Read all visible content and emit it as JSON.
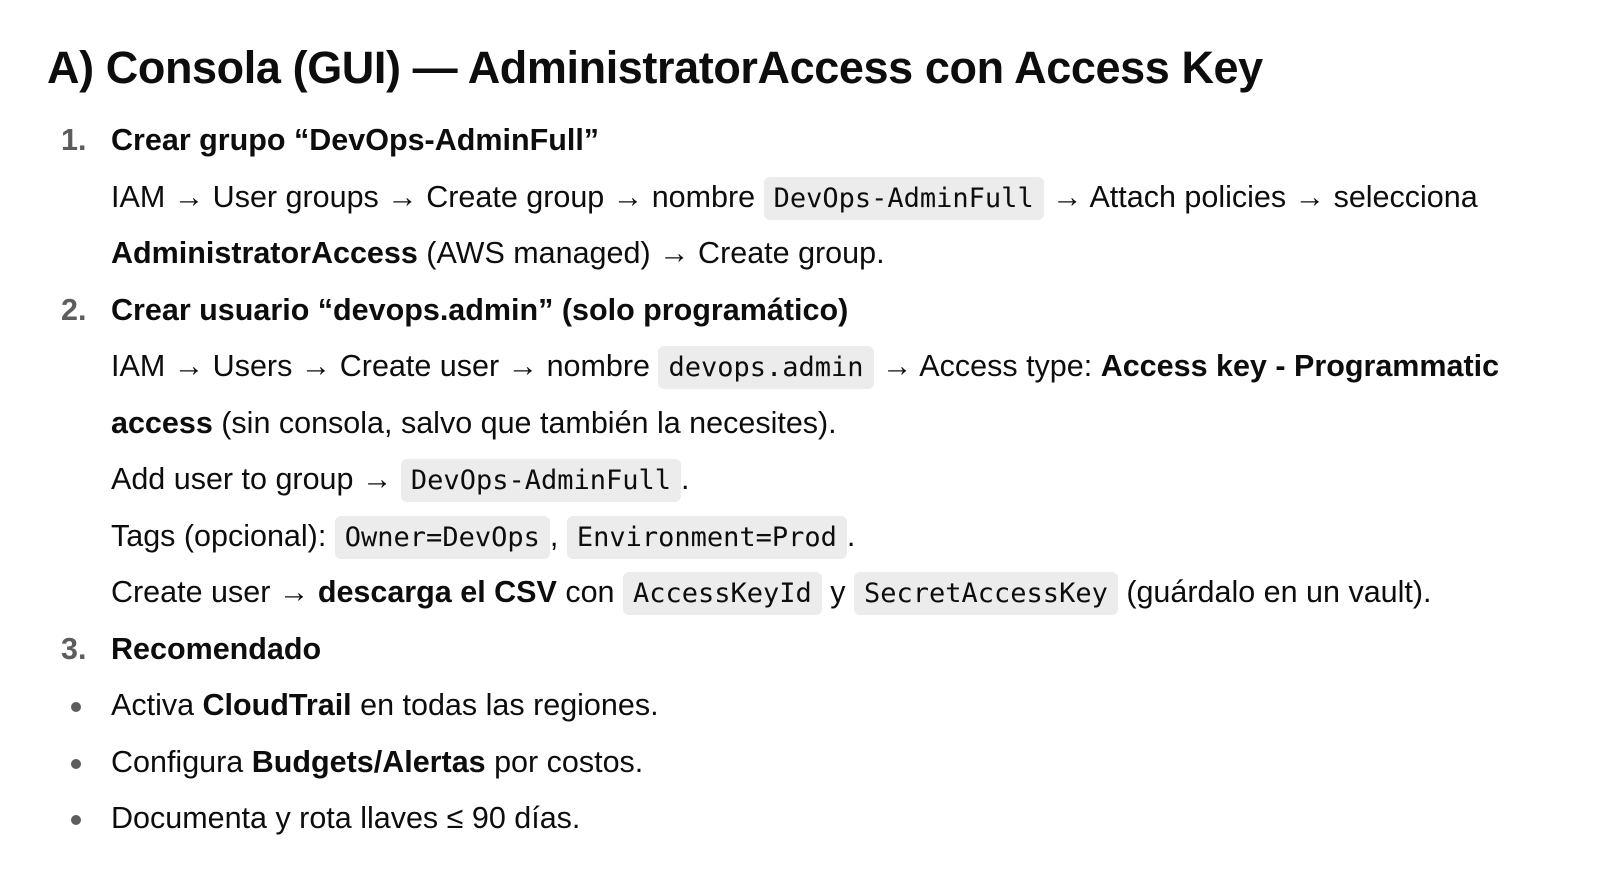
{
  "title": "A) Consola (GUI) — AdministratorAccess con Access Key",
  "steps": [
    {
      "number": "1.",
      "heading": "Crear grupo “DevOps-AdminFull”",
      "l1_a": "IAM → User groups → Create group → nombre ",
      "l1_code": "DevOps-AdminFull",
      "l1_b": " → Attach policies → selecciona",
      "l2_bold": "AdministratorAccess",
      "l2_b": " (AWS managed) → Create group."
    },
    {
      "number": "2.",
      "heading": "Crear usuario “devops.admin” (solo programático)",
      "l1_a": "IAM → Users → Create user → nombre ",
      "l1_code": "devops.admin",
      "l1_b": " → Access type: ",
      "l1_bold": "Access key - Programmatic",
      "l2_bold": "access",
      "l2_b": " (sin consola, salvo que también la necesites).",
      "l3_a": "Add user to group → ",
      "l3_code": "DevOps-AdminFull",
      "l3_b": ".",
      "l4_a": "Tags (opcional): ",
      "l4_code1": "Owner=DevOps",
      "l4_sep": ", ",
      "l4_code2": "Environment=Prod",
      "l4_b": ".",
      "l5_a": "Create user → ",
      "l5_bold": "descarga el CSV",
      "l5_b": " con ",
      "l5_code1": "AccessKeyId",
      "l5_c": " y ",
      "l5_code2": "SecretAccessKey",
      "l5_d": " (guárdalo en un vault)."
    },
    {
      "number": "3.",
      "heading": "Recomendado"
    }
  ],
  "bullets": [
    {
      "pre": "Activa ",
      "bold": "CloudTrail",
      "post": " en todas las regiones."
    },
    {
      "pre": "Configura ",
      "bold": "Budgets/Alertas",
      "post": " por costos."
    },
    {
      "pre": "Documenta y rota llaves ≤ 90 días.",
      "bold": "",
      "post": ""
    }
  ]
}
